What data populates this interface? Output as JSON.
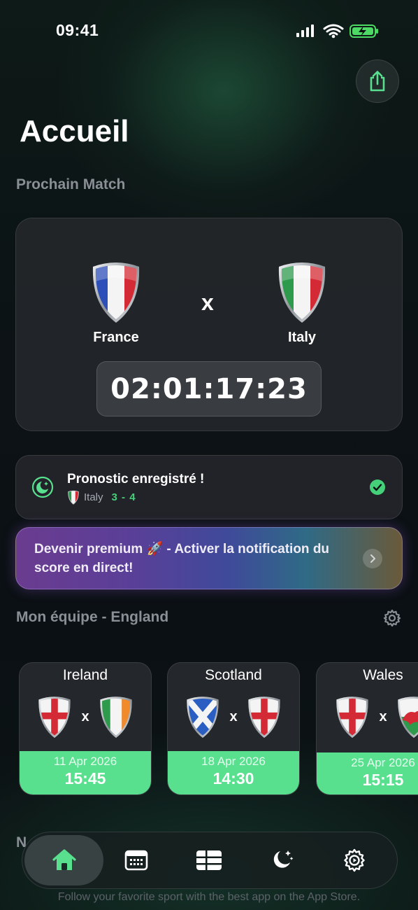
{
  "status_bar": {
    "time": "09:41"
  },
  "header": {
    "title": "Accueil",
    "share_icon": "share-icon"
  },
  "next_match": {
    "section_label": "Prochain Match",
    "home_team": "France",
    "away_team": "Italy",
    "vs": "x",
    "countdown": "02:01:17:23"
  },
  "prediction": {
    "title": "Pronostic enregistré !",
    "team": "Italy",
    "score": "3 - 4"
  },
  "premium": {
    "text": "Devenir premium 🚀 - Activer la notification du score en direct!"
  },
  "my_team": {
    "section_label": "Mon équipe - England",
    "fixtures": [
      {
        "opponent": "Ireland",
        "vs": "x",
        "date": "11 Apr 2026",
        "time": "15:45"
      },
      {
        "opponent": "Scotland",
        "vs": "x",
        "date": "18 Apr 2026",
        "time": "14:30"
      },
      {
        "opponent": "Wales",
        "vs": "x",
        "date": "25 Apr 2026",
        "time": "15:15"
      }
    ]
  },
  "partial_section_label": "N",
  "footer": {
    "text": "Follow your favorite sport with the best app on the App Store."
  },
  "tabbar": {
    "items": [
      "home-icon",
      "calendar-icon",
      "table-icon",
      "moon-stars-icon",
      "settings-icon"
    ],
    "active": "home-icon"
  },
  "colors": {
    "accent": "#58e08f",
    "score_green": "#45d17a",
    "background": "#0b1013"
  }
}
